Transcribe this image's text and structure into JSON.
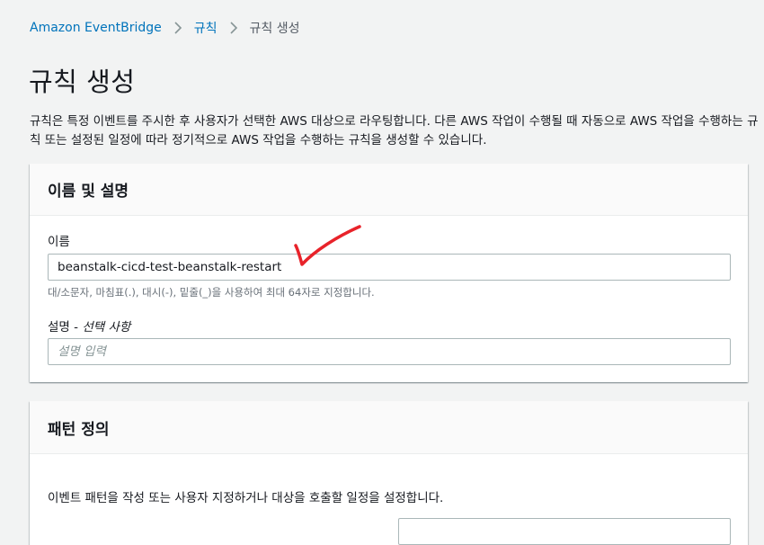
{
  "breadcrumb": {
    "items": [
      {
        "label": "Amazon EventBridge"
      },
      {
        "label": "규칙"
      },
      {
        "label": "규칙 생성"
      }
    ]
  },
  "page": {
    "title": "규칙 생성",
    "description": "규칙은 특정 이벤트를 주시한 후 사용자가 선택한 AWS 대상으로 라우팅합니다. 다른 AWS 작업이 수행될 때 자동으로 AWS 작업을 수행하는 규칙 또는 설정된 일정에 따라 정기적으로 AWS 작업을 수행하는 규칙을 생성할 수 있습니다."
  },
  "name_panel": {
    "title": "이름 및 설명",
    "name_label": "이름",
    "name_value": "beanstalk-cicd-test-beanstalk-restart",
    "name_hint": "대/소문자, 마침표(.), 대시(-), 밑줄(_)을 사용하여 최대 64자로 지정합니다.",
    "description_label": "설명",
    "description_optional": "선택 사항",
    "description_separator": " - ",
    "description_placeholder": "설명 입력"
  },
  "pattern_panel": {
    "title": "패턴 정의",
    "description": "이벤트 패턴을 작성 또는 사용자 지정하거나 대상을 호출할 일정을 설정합니다."
  },
  "colors": {
    "link": "#0073bb",
    "background": "#f2f3f3",
    "annotation": "#e8232a"
  },
  "icons": {
    "breadcrumb_separator": "chevron-right-icon",
    "annotation": "red-checkmark-annotation"
  }
}
